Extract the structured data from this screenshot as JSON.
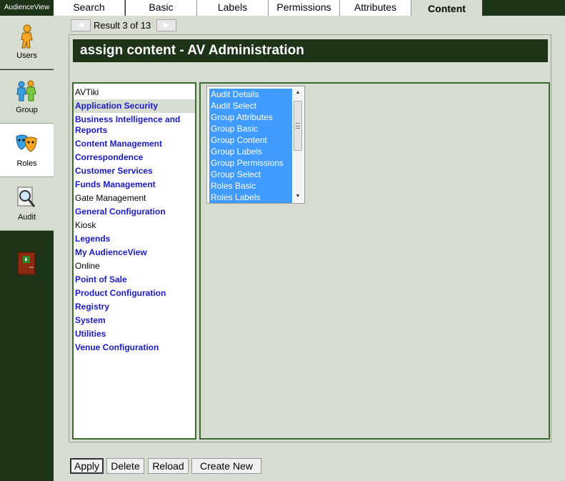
{
  "app": {
    "brand": "AudienceView"
  },
  "sidebar": {
    "items": [
      {
        "label": "Users",
        "icon": "user-icon"
      },
      {
        "label": "Group",
        "icon": "group-icon"
      },
      {
        "label": "Roles",
        "icon": "roles-masks-icon",
        "active": true
      },
      {
        "label": "Audit",
        "icon": "audit-magnifier-icon"
      }
    ],
    "exit_icon": "exit-door-icon"
  },
  "tabs": [
    {
      "label": "Search"
    },
    {
      "label": "Basic"
    },
    {
      "label": "Labels"
    },
    {
      "label": "Permissions"
    },
    {
      "label": "Attributes"
    },
    {
      "label": "Content",
      "active": true
    }
  ],
  "pager": {
    "prev": "◀",
    "next": "▶",
    "text": "Result 3 of 13"
  },
  "main": {
    "title": "assign content - AV Administration"
  },
  "categories": [
    {
      "label": "AVTiki",
      "style": "plain"
    },
    {
      "label": "Application Security",
      "style": "link",
      "selected": true
    },
    {
      "label": "Business Intelligence and Reports",
      "style": "link"
    },
    {
      "label": "Content Management",
      "style": "link"
    },
    {
      "label": "Correspondence",
      "style": "link"
    },
    {
      "label": "Customer Services",
      "style": "link"
    },
    {
      "label": "Funds Management",
      "style": "link"
    },
    {
      "label": "Gate Management",
      "style": "plain"
    },
    {
      "label": "General Configuration",
      "style": "link"
    },
    {
      "label": "Kiosk",
      "style": "plain"
    },
    {
      "label": "Legends",
      "style": "link"
    },
    {
      "label": "My AudienceView",
      "style": "link"
    },
    {
      "label": "Online",
      "style": "plain"
    },
    {
      "label": "Point of Sale",
      "style": "link"
    },
    {
      "label": "Product Configuration",
      "style": "link"
    },
    {
      "label": "Registry",
      "style": "link"
    },
    {
      "label": "System",
      "style": "link"
    },
    {
      "label": "Utilities",
      "style": "link"
    },
    {
      "label": "Venue Configuration",
      "style": "link"
    }
  ],
  "content_items": [
    "Audit Details",
    "Audit Select",
    "Group Attributes",
    "Group Basic",
    "Group Content",
    "Group Labels",
    "Group Permissions",
    "Group Select",
    "Roles Basic",
    "Roles Labels"
  ],
  "buttons": {
    "apply": "Apply",
    "delete": "Delete",
    "reload": "Reload",
    "create_new": "Create New"
  },
  "colors": {
    "dark_green": "#1e3418",
    "panel_bg": "#d6dccf",
    "selection_blue": "#3f9bfd",
    "link_blue": "#1a1ac8"
  }
}
